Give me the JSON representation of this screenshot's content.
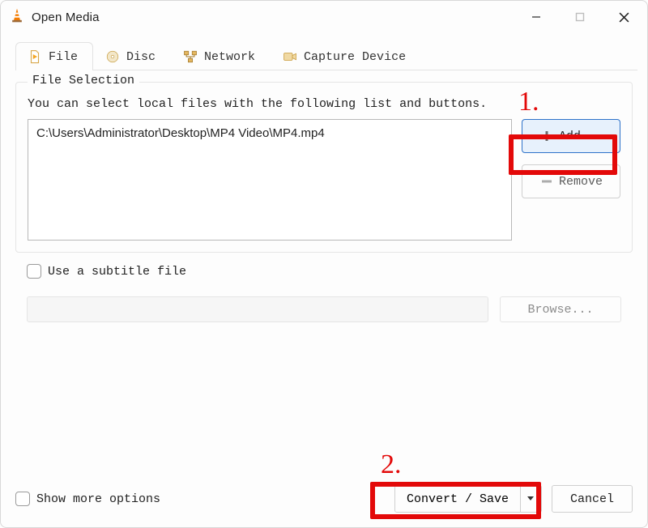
{
  "window": {
    "title": "Open Media"
  },
  "tabs": {
    "file": "File",
    "disc": "Disc",
    "network": "Network",
    "capture": "Capture Device"
  },
  "file_section": {
    "legend": "File Selection",
    "description": "You can select local files with the following list and buttons.",
    "files": [
      "C:\\Users\\Administrator\\Desktop\\MP4 Video\\MP4.mp4"
    ],
    "add_label": "Add...",
    "remove_label": "Remove"
  },
  "subtitle": {
    "checkbox_label": "Use a subtitle file",
    "browse_label": "Browse..."
  },
  "footer": {
    "show_more": "Show more options",
    "convert_label": "Convert / Save",
    "cancel_label": "Cancel"
  },
  "annotations": {
    "one": "1.",
    "two": "2."
  }
}
